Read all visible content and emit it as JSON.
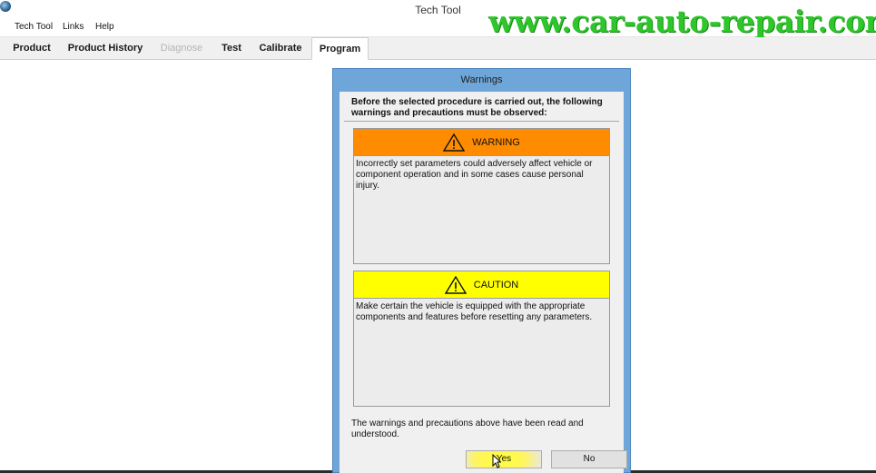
{
  "window": {
    "title": "Tech Tool"
  },
  "watermark": {
    "text": "www.car-auto-repair.com"
  },
  "menu": [
    "Tech Tool",
    "Links",
    "Help"
  ],
  "tabs": [
    {
      "label": "Product",
      "state": "normal"
    },
    {
      "label": "Product History",
      "state": "normal"
    },
    {
      "label": "Diagnose",
      "state": "disabled"
    },
    {
      "label": "Test",
      "state": "normal"
    },
    {
      "label": "Calibrate",
      "state": "normal"
    },
    {
      "label": "Program",
      "state": "active"
    }
  ],
  "dialog": {
    "title": "Warnings",
    "intro": "Before the selected procedure is carried out, the following warnings and precautions must be observed:",
    "warning": {
      "label": "WARNING",
      "text": "Incorrectly set parameters could adversely affect vehicle or component operation and in some cases cause personal injury.",
      "color": "#ff8c00"
    },
    "caution": {
      "label": "CAUTION",
      "text": "Make certain the vehicle is equipped with the appropriate components and features before resetting any parameters.",
      "color": "#ffff00"
    },
    "confirm_text": "The warnings and precautions above have been read and understood.",
    "yes_label": "Yes",
    "no_label": "No"
  },
  "colors": {
    "dialog_frame": "#6fa6d9",
    "watermark": "#2ec62a"
  },
  "icons": {
    "app": "tech-tool-app-icon",
    "warning": "warning-triangle-icon",
    "caution": "caution-triangle-icon",
    "cursor": "mouse-pointer-icon"
  }
}
